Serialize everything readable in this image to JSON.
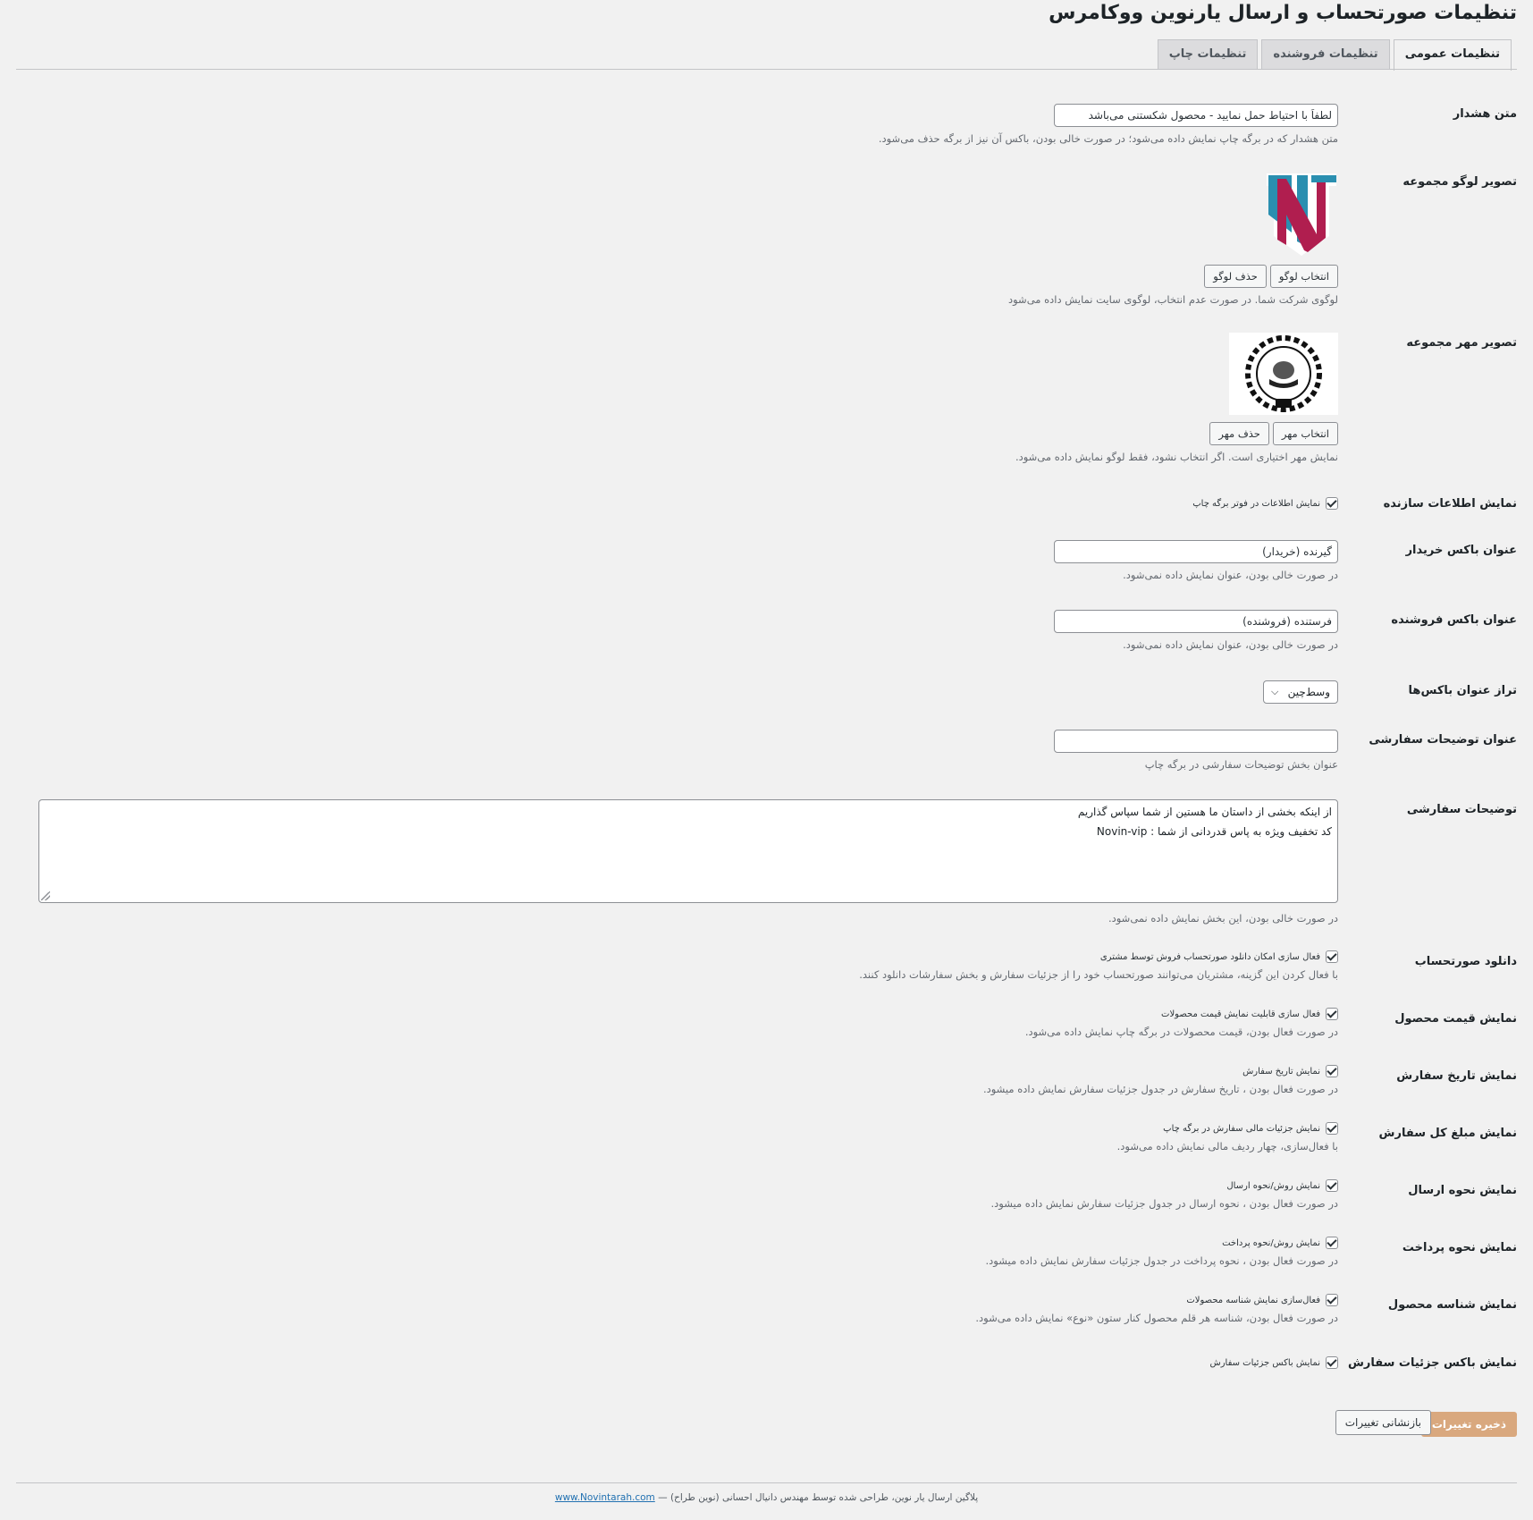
{
  "page": {
    "title": "تنظیمات صورتحساب و ارسال یارنوین ووکامرس"
  },
  "tabs": [
    {
      "label": "تنظیمات عمومی",
      "active": true
    },
    {
      "label": "تنظیمات فروشنده",
      "active": false
    },
    {
      "label": "تنظیمات چاپ",
      "active": false
    }
  ],
  "warning_text": {
    "label": "متن هشدار",
    "value": "لطفاً با احتیاط حمل نمایید - محصول شکستنی می‌باشد",
    "description": "متن هشدار که در برگه چاپ نمایش داده می‌شود؛ در صورت خالی بودن، باکس آن نیز از برگه حذف می‌شود."
  },
  "logo": {
    "label": "تصویر لوگو مجموعه",
    "select_button": "انتخاب لوگو",
    "remove_button": "حذف لوگو",
    "description": "لوگوی شرکت شما. در صورت عدم انتخاب، لوگوی سایت نمایش داده می‌شود"
  },
  "seal": {
    "label": "تصویر مهر مجموعه",
    "select_button": "انتخاب مهر",
    "remove_button": "حذف مهر",
    "description": "نمایش مهر اختیاری است. اگر انتخاب نشود، فقط لوگو نمایش داده می‌شود."
  },
  "creator_info": {
    "label": "نمایش اطلاعات سازنده",
    "checkbox_label": "نمایش اطلاعات در فوتر برگه چاپ"
  },
  "buyer_box": {
    "label": "عنوان باکس خریدار",
    "value": "گیرنده (خریدار)",
    "description": "در صورت خالی بودن، عنوان نمایش داده نمی‌شود."
  },
  "seller_box": {
    "label": "عنوان باکس فروشنده",
    "value": "فرستنده (فروشنده)",
    "description": "در صورت خالی بودن، عنوان نمایش داده نمی‌شود."
  },
  "box_align": {
    "label": "تراز عنوان باکس‌ها",
    "selected": "وسط‌چین"
  },
  "custom_notes_title": {
    "label": "عنوان توضیحات سفارشی",
    "value": "",
    "description": "عنوان بخش توضیحات سفارشی در برگه چاپ"
  },
  "custom_notes": {
    "label": "توضیحات سفارشی",
    "line1": "از اینکه بخشی از داستان ما هستین از شما سپاس گذاریم",
    "line2": "کد تخفیف ویژه به پاس قدردانی از شما : Novin-vip",
    "description": "در صورت خالی بودن، این بخش نمایش داده نمی‌شود."
  },
  "invoice_download": {
    "label": "دانلود صورتحساب",
    "checkbox_label": "فعال سازی امکان دانلود صورتحساب فروش توسط مشتری",
    "description": "با فعال کردن این گزینه، مشتریان می‌توانند صورتحساب خود را از جزئیات سفارش و بخش سفارشات دانلود کنند."
  },
  "product_price": {
    "label": "نمایش قیمت محصول",
    "checkbox_label": "فعال سازی قابلیت نمایش قیمت محصولات",
    "description": "در صورت فعال بودن، قیمت محصولات در برگه چاپ نمایش داده می‌شود."
  },
  "order_date": {
    "label": "نمایش تاریخ سفارش",
    "checkbox_label": "نمایش تاریخ سفارش",
    "description": "در صورت فعال بودن ، تاریخ سفارش در جدول جزئیات سفارش نمایش داده میشود."
  },
  "order_total": {
    "label": "نمایش مبلغ کل سفارش",
    "checkbox_label": "نمایش جزئیات مالی سفارش در برگه چاپ",
    "description": "با فعال‌سازی، چهار ردیف مالی نمایش داده می‌شود."
  },
  "shipping_method": {
    "label": "نمایش نحوه ارسال",
    "checkbox_label": "نمایش روش/نحوه ارسال",
    "description": "در صورت فعال بودن ، نحوه ارسال در جدول جزئیات سفارش نمایش داده میشود."
  },
  "payment_method": {
    "label": "نمایش نحوه پرداخت",
    "checkbox_label": "نمایش روش/نحوه پرداخت",
    "description": "در صورت فعال بودن ، نحوه پرداخت در جدول جزئیات سفارش نمایش داده میشود."
  },
  "product_sku": {
    "label": "نمایش شناسه محصول",
    "checkbox_label": "فعال‌سازی نمایش شناسه محصولات",
    "description": "در صورت فعال بودن، شناسه هر قلم محصول کنار ستون «نوع» نمایش داده می‌شود."
  },
  "order_details_box": {
    "label": "نمایش باکس جزئیات سفارش",
    "checkbox_label": "نمایش باکس جزئیات سفارش"
  },
  "actions": {
    "save": "ذخیره تغییرات",
    "reset": "بازنشانی تغییرات"
  },
  "footer": {
    "text": "پلاگین ارسال یار نوین، طراحی شده توسط مهندس دانیال احسانی (نوین طراح) —",
    "link": "www.Novintarah.com"
  },
  "colors": {
    "primary_button": "#d9a87e",
    "link": "#2271b1",
    "logo_blue": "#2a8fb0",
    "logo_red": "#b01e4f"
  }
}
